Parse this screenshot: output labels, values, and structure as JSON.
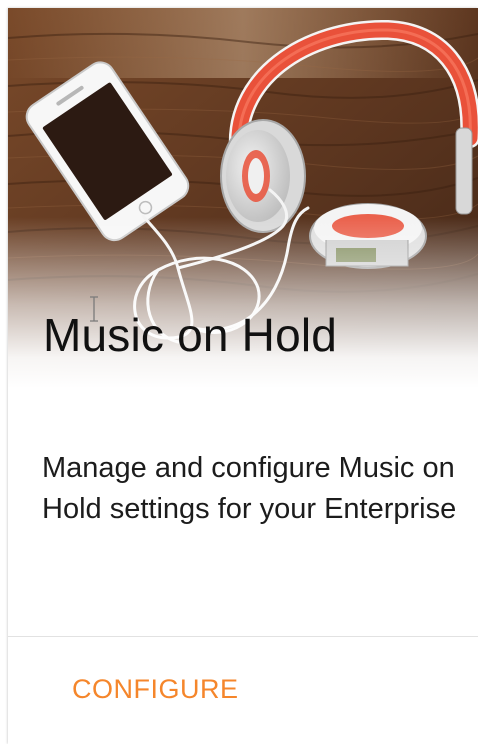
{
  "card": {
    "title": "Music on Hold",
    "description": "Manage and configure Music on Hold settings for your Enterprise",
    "action_label": "CONFIGURE"
  },
  "colors": {
    "accent": "#f5862b",
    "title_text": "#111111",
    "body_text": "#1c1c1c",
    "divider": "#e2e2e2",
    "wood": "#6a3f24",
    "headphone_band": "#e9513a"
  },
  "icons": {
    "hero_image": "phone-with-headphones-photo",
    "cursor": "text-cursor-icon"
  }
}
